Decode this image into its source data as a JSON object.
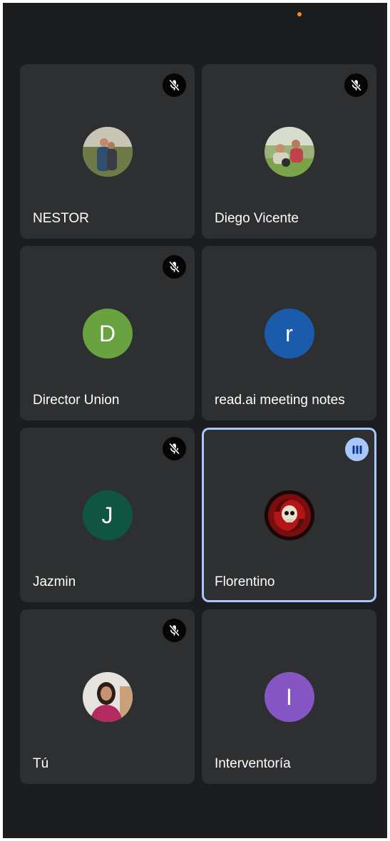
{
  "participants": [
    {
      "name": "NESTOR",
      "muted": true,
      "speaking": false,
      "avatar_type": "photo",
      "icon": "photo-avatar-icon"
    },
    {
      "name": "Diego Vicente",
      "muted": true,
      "speaking": false,
      "avatar_type": "photo",
      "icon": "photo-avatar-icon"
    },
    {
      "name": "Director Union",
      "muted": true,
      "speaking": false,
      "avatar_type": "letter",
      "letter": "D",
      "color": "#6aa23f"
    },
    {
      "name": "read.ai meeting notes",
      "muted": false,
      "speaking": false,
      "avatar_type": "letter",
      "letter": "r",
      "color": "#1a5cab"
    },
    {
      "name": "Jazmin",
      "muted": true,
      "speaking": false,
      "avatar_type": "letter",
      "letter": "J",
      "color": "#105542"
    },
    {
      "name": "Florentino",
      "muted": false,
      "speaking": true,
      "avatar_type": "photo",
      "icon": "skull-avatar-icon"
    },
    {
      "name": "Tú",
      "muted": true,
      "speaking": false,
      "avatar_type": "photo",
      "icon": "photo-avatar-icon"
    },
    {
      "name": "Interventoría",
      "muted": false,
      "speaking": false,
      "avatar_type": "letter",
      "letter": "I",
      "color": "#8656c5"
    }
  ],
  "icons": {
    "muted": "mic-off-icon",
    "speaking": "audio-level-icon",
    "status_dot": "recording-dot-icon"
  },
  "colors": {
    "background": "#1c1d1f",
    "tile": "#2d2f31",
    "speaking_border": "#a8c7fa",
    "status_dot": "#f28b2f"
  }
}
